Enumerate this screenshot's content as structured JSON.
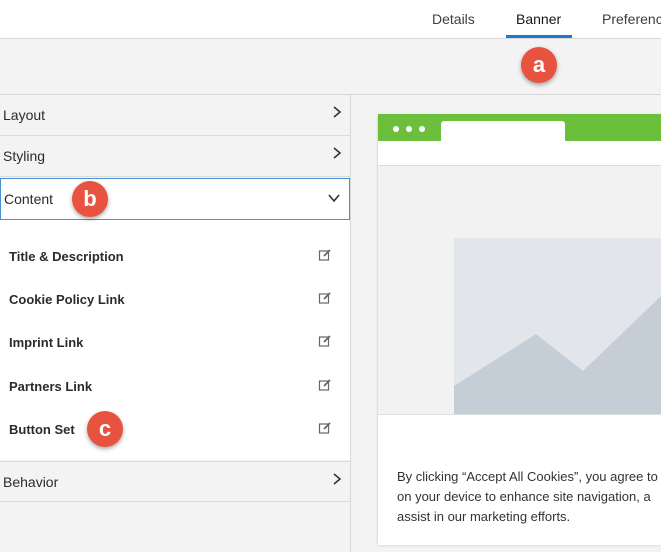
{
  "tabs": {
    "details": "Details",
    "banner": "Banner",
    "preferences": "Preferenc"
  },
  "callouts": {
    "a": "a",
    "b": "b",
    "c": "c"
  },
  "sections": {
    "layout": "Layout",
    "styling": "Styling",
    "content": "Content",
    "behavior": "Behavior"
  },
  "content_items": [
    "Title & Description",
    "Cookie Policy Link",
    "Imprint Link",
    "Partners Link",
    "Button Set"
  ],
  "preview": {
    "banner_text_line1": "By clicking “Accept All Cookies”, you agree to",
    "banner_text_line2": "on your device to enhance site navigation, a",
    "banner_text_line3": "assist in our marketing efforts."
  },
  "icons": {
    "chevron_right": "chevron-right-icon",
    "chevron_down": "chevron-down-icon",
    "edit": "edit-icon"
  },
  "colors": {
    "accent": "#1b7ad1",
    "callout": "#e8533f",
    "browser_bar": "#6cbf3c",
    "placeholder_mountain": "#c5ced6"
  }
}
